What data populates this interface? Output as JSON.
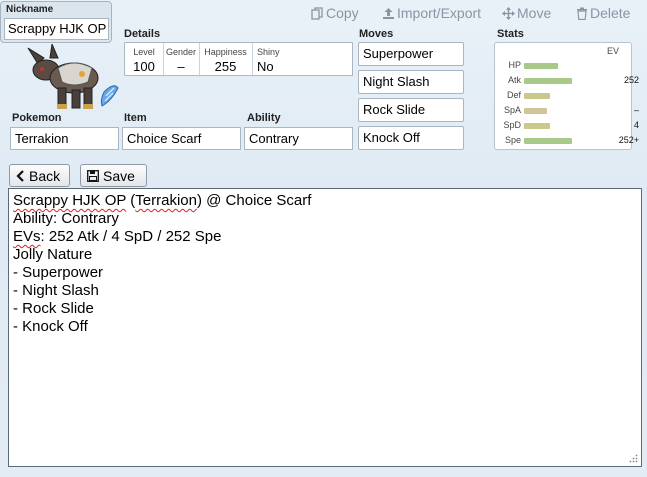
{
  "nickname": {
    "label": "Nickname",
    "value": "Scrappy HJK OP"
  },
  "toolbar": {
    "copy": "Copy",
    "import_export": "Import/Export",
    "move": "Move",
    "delete": "Delete"
  },
  "details": {
    "label": "Details",
    "level": {
      "label": "Level",
      "value": "100"
    },
    "gender": {
      "label": "Gender",
      "value": "–"
    },
    "happiness": {
      "label": "Happiness",
      "value": "255"
    },
    "shiny": {
      "label": "Shiny",
      "value": "No"
    }
  },
  "pokemon": {
    "label": "Pokemon",
    "value": "Terrakion"
  },
  "item": {
    "label": "Item",
    "value": "Choice Scarf"
  },
  "ability": {
    "label": "Ability",
    "value": "Contrary"
  },
  "moves": {
    "label": "Moves",
    "list": [
      "Superpower",
      "Night Slash",
      "Rock Slide",
      "Knock Off"
    ]
  },
  "stats": {
    "label": "Stats",
    "ev_header": "EV",
    "rows": [
      {
        "name": "HP",
        "ev": "",
        "bar_fraction": 0.28,
        "color": "#a9c98b"
      },
      {
        "name": "Atk",
        "ev": "252",
        "bar_fraction": 0.4,
        "color": "#a9c98b"
      },
      {
        "name": "Def",
        "ev": "",
        "bar_fraction": 0.22,
        "color": "#c9c98b"
      },
      {
        "name": "SpA",
        "ev": "–",
        "bar_fraction": 0.19,
        "color": "#d2c49a"
      },
      {
        "name": "SpD",
        "ev": "4",
        "bar_fraction": 0.22,
        "color": "#c9c98b"
      },
      {
        "name": "Spe",
        "ev": "252+",
        "bar_fraction": 0.4,
        "color": "#a9c98b"
      }
    ]
  },
  "buttons": {
    "back": "Back",
    "save": "Save"
  },
  "export": {
    "nickname": "Scrappy HJK OP",
    "species": "Terrakion",
    "item": "Choice Scarf",
    "ability_line": "Ability: Contrary",
    "ev_prefix": "EVs",
    "ev_rest": ": 252 Atk / 4 SpD / 252 Spe",
    "nature_line": "Jolly Nature",
    "moves": [
      "- Superpower",
      "- Night Slash",
      "- Rock Slide",
      "- Knock Off"
    ]
  }
}
